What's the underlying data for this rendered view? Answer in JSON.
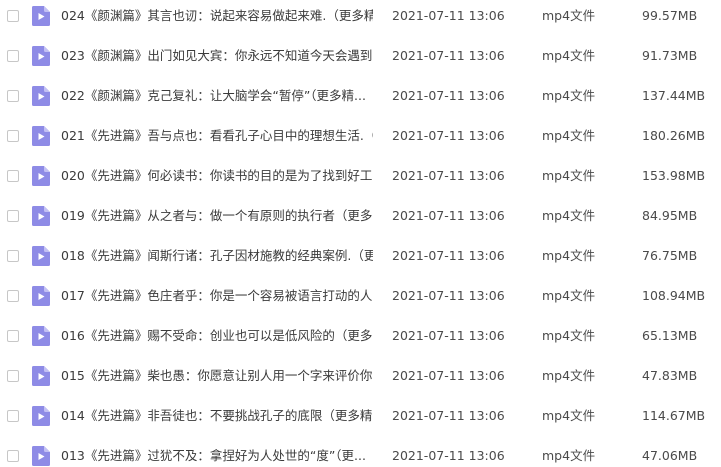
{
  "file_type_icon": "video-file-icon",
  "colors": {
    "icon_fill": "#8e8be6",
    "icon_fold": "#c3c1f4",
    "text": "#3b3b3b",
    "checkbox_border": "#c7c7c7"
  },
  "files": [
    {
      "name": "024《颜渊篇》其言也讱：说起来容易做起来难.（更多精...",
      "date": "2021-07-11 13:06",
      "type": "mp4文件",
      "size": "99.57MB"
    },
    {
      "name": "023《颜渊篇》出门如见大宾：你永远不知道今天会遇到...",
      "date": "2021-07-11 13:06",
      "type": "mp4文件",
      "size": "91.73MB"
    },
    {
      "name": "022《颜渊篇》克己复礼：让大脑学会“暂停”（更多精...",
      "date": "2021-07-11 13:06",
      "type": "mp4文件",
      "size": "137.44MB"
    },
    {
      "name": "021《先进篇》吾与点也：看看孔子心目中的理想生活.（...",
      "date": "2021-07-11 13:06",
      "type": "mp4文件",
      "size": "180.26MB"
    },
    {
      "name": "020《先进篇》何必读书：你读书的目的是为了找到好工...",
      "date": "2021-07-11 13:06",
      "type": "mp4文件",
      "size": "153.98MB"
    },
    {
      "name": "019《先进篇》从之者与：做一个有原则的执行者（更多...",
      "date": "2021-07-11 13:06",
      "type": "mp4文件",
      "size": "84.95MB"
    },
    {
      "name": "018《先进篇》闻斯行诸：孔子因材施教的经典案例.（更...",
      "date": "2021-07-11 13:06",
      "type": "mp4文件",
      "size": "76.75MB"
    },
    {
      "name": "017《先进篇》色庄者乎：你是一个容易被语言打动的人...",
      "date": "2021-07-11 13:06",
      "type": "mp4文件",
      "size": "108.94MB"
    },
    {
      "name": "016《先进篇》赐不受命：创业也可以是低风险的（更多...",
      "date": "2021-07-11 13:06",
      "type": "mp4文件",
      "size": "65.13MB"
    },
    {
      "name": "015《先进篇》柴也愚：你愿意让别人用一个字来评价你...",
      "date": "2021-07-11 13:06",
      "type": "mp4文件",
      "size": "47.83MB"
    },
    {
      "name": "014《先进篇》非吾徒也：不要挑战孔子的底限（更多精...",
      "date": "2021-07-11 13:06",
      "type": "mp4文件",
      "size": "114.67MB"
    },
    {
      "name": "013《先进篇》过犹不及：拿捏好为人处世的“度”（更...",
      "date": "2021-07-11 13:06",
      "type": "mp4文件",
      "size": "47.06MB"
    }
  ]
}
